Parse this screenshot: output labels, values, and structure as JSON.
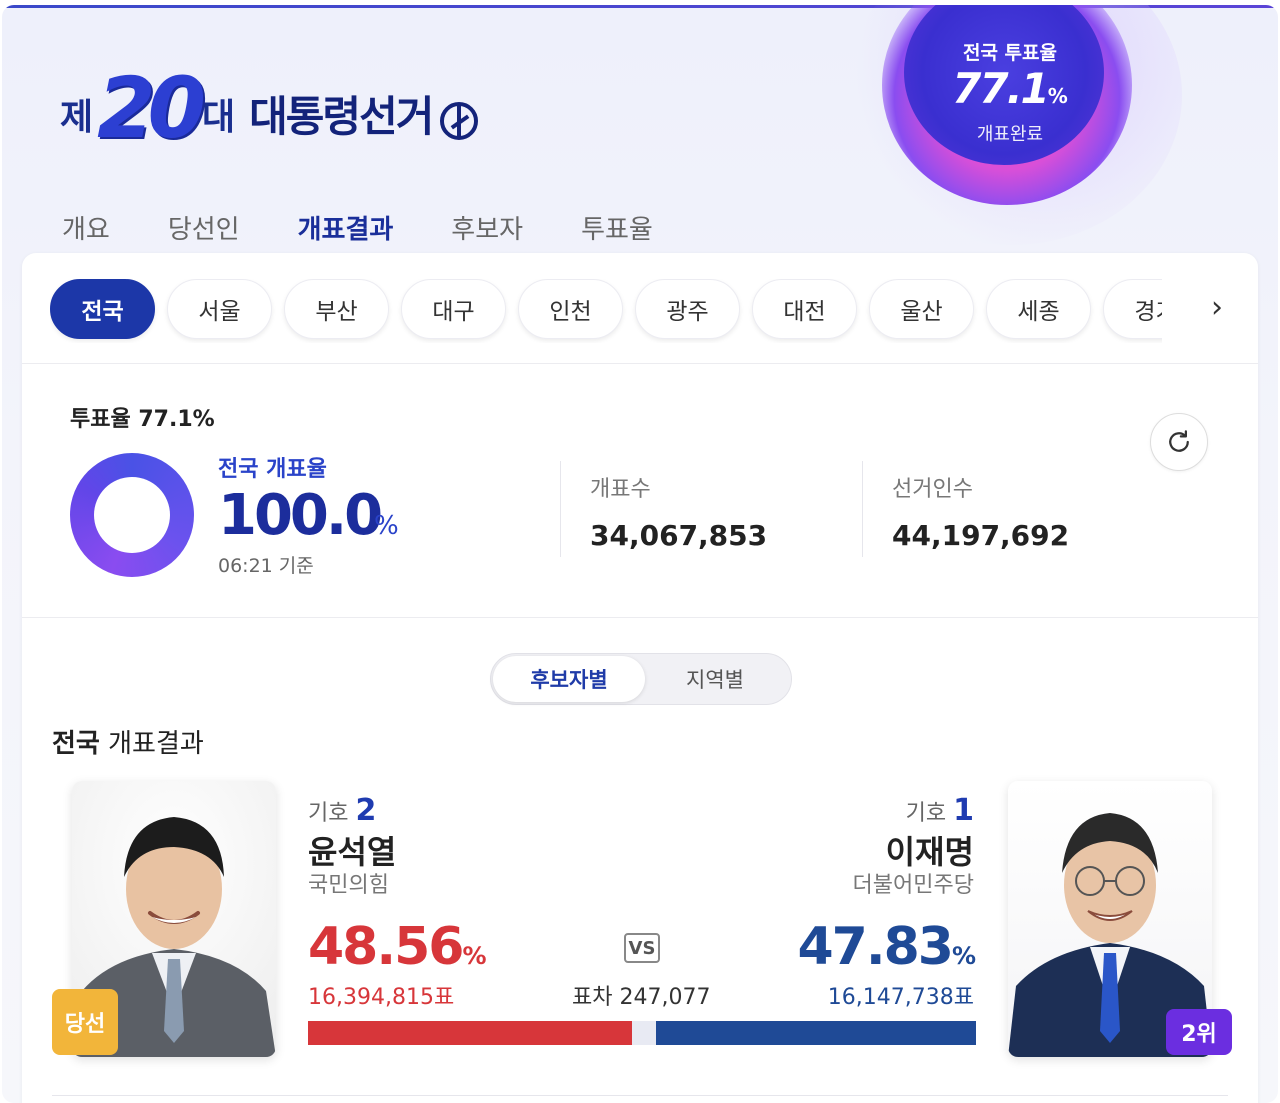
{
  "header": {
    "title_prefix": "제",
    "title_number": "20",
    "title_suffix": "대",
    "title_main": "대통령선거",
    "turnout_badge": {
      "label": "전국 투표율",
      "value": "77.1",
      "unit": "%",
      "status": "개표완료"
    }
  },
  "tabs": [
    "개요",
    "당선인",
    "개표결과",
    "후보자",
    "투표율"
  ],
  "active_tab": "개표결과",
  "regions": [
    "전국",
    "서울",
    "부산",
    "대구",
    "인천",
    "광주",
    "대전",
    "울산",
    "세종",
    "경기"
  ],
  "summary": {
    "turnout_label": "투표율 77.1%",
    "count_label": "전국 개표율",
    "count_value": "100.0",
    "count_unit": "%",
    "count_progress": 1.0,
    "timestamp": "06:21 기준",
    "ballots_label": "개표수",
    "ballots_value": "34,067,853",
    "electorate_label": "선거인수",
    "electorate_value": "44,197,692"
  },
  "view_toggle": {
    "on": "후보자별",
    "off": "지역별"
  },
  "section": {
    "bold": "전국",
    "rest": " 개표결과"
  },
  "candidates": {
    "left": {
      "number_label": "기호",
      "number": "2",
      "name": "윤석열",
      "party": "국민의힘",
      "pct": "48.56",
      "pct_unit": "%",
      "votes": "16,394,815표",
      "badge": "당선",
      "color": "#d7363a"
    },
    "right": {
      "number_label": "기호",
      "number": "1",
      "name": "이재명",
      "party": "더불어민주당",
      "pct": "47.83",
      "pct_unit": "%",
      "votes": "16,147,738표",
      "badge": "2위",
      "color": "#1f4a96"
    },
    "vs": "VS",
    "diff": "표차 247,077"
  },
  "colors": {
    "accent": "#1c37a8",
    "winner": "#d7363a",
    "runner_up": "#1f4a96",
    "badge_gold": "#f2b53a",
    "badge_purple": "#6b2ee0"
  }
}
